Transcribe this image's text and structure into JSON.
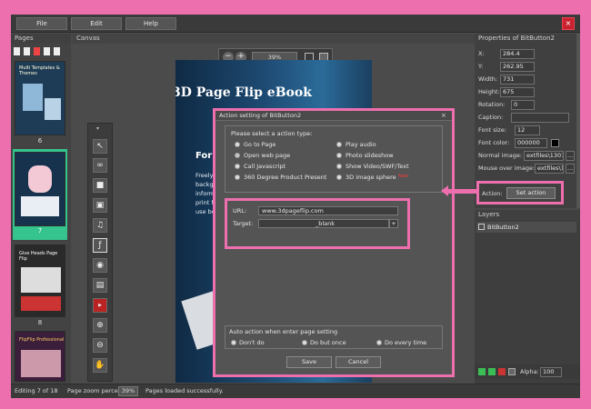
{
  "menu": {
    "file": "File",
    "edit": "Edit",
    "help": "Help",
    "close_glyph": "×"
  },
  "pages_panel": {
    "title": "Pages",
    "thumbs": [
      {
        "label": "6",
        "heading": "Multi Templates & Themes"
      },
      {
        "label": "7",
        "heading": ""
      },
      {
        "label": "8",
        "heading": "Give Heads Page Flip"
      },
      {
        "label": "",
        "heading": "FlipFlip Professional"
      }
    ]
  },
  "canvas": {
    "title": "Canvas",
    "zoom_value": "39%",
    "page_title": "3D Page Flip eBook",
    "page_for": "For",
    "page_body_lines": [
      "Freely t",
      "backgro",
      "informat",
      "print fli",
      "use boo"
    ]
  },
  "dialog": {
    "title": "Action setting of BitButton2",
    "prompt": "Please select a action type:",
    "options_left": [
      "Go to Page",
      "Open web page",
      "Call Javascript",
      "360 Degree Product Present"
    ],
    "options_right": [
      "Play audio",
      "Photo slideshow",
      "Show Video/SWF/Text",
      "3D image sphere"
    ],
    "selected": "Open web page",
    "new_badge": "New",
    "url_label": "URL:",
    "url_value": "www.3dpageflip.com",
    "target_label": "Target:",
    "target_value": "_blank",
    "target_btn": "+",
    "auto_title": "Auto action when enter page setting",
    "auto_options": [
      "Don't do",
      "Do but once",
      "Do every time"
    ],
    "save": "Save",
    "cancel": "Cancel"
  },
  "properties": {
    "title": "Properties of BitButton2",
    "rows": [
      {
        "label": "X:",
        "value": "284.4"
      },
      {
        "label": "Y:",
        "value": "262.95"
      },
      {
        "label": "Width:",
        "value": "731"
      },
      {
        "label": "Height:",
        "value": "675"
      },
      {
        "label": "Rotation:",
        "value": "0"
      },
      {
        "label": "Caption:",
        "value": ""
      }
    ],
    "font_size_label": "Font size:",
    "font_size_value": "12",
    "font_color_label": "Font color:",
    "font_color_value": "000000",
    "normal_image_label": "Normal image:",
    "normal_image_value": "extfiles\\13011\\",
    "mouse_over_label": "Mouse over image:",
    "mouse_over_value": "extfiles\\13",
    "browse": "...",
    "action_label": "Action:",
    "set_action": "Set action"
  },
  "layers": {
    "title": "Layers",
    "items": [
      "BitButton2"
    ],
    "alpha_label": "Alpha:",
    "alpha_value": "100"
  },
  "status": {
    "editing": "Editing 7 of 18",
    "zoom_label": "Page zoom percent:",
    "zoom_value": "39%",
    "message": "Pages loaded successfully."
  },
  "colors": {
    "accent_pink": "#ee6fae",
    "selected_thumb": "#35c48e",
    "close_red": "#c9212e"
  }
}
